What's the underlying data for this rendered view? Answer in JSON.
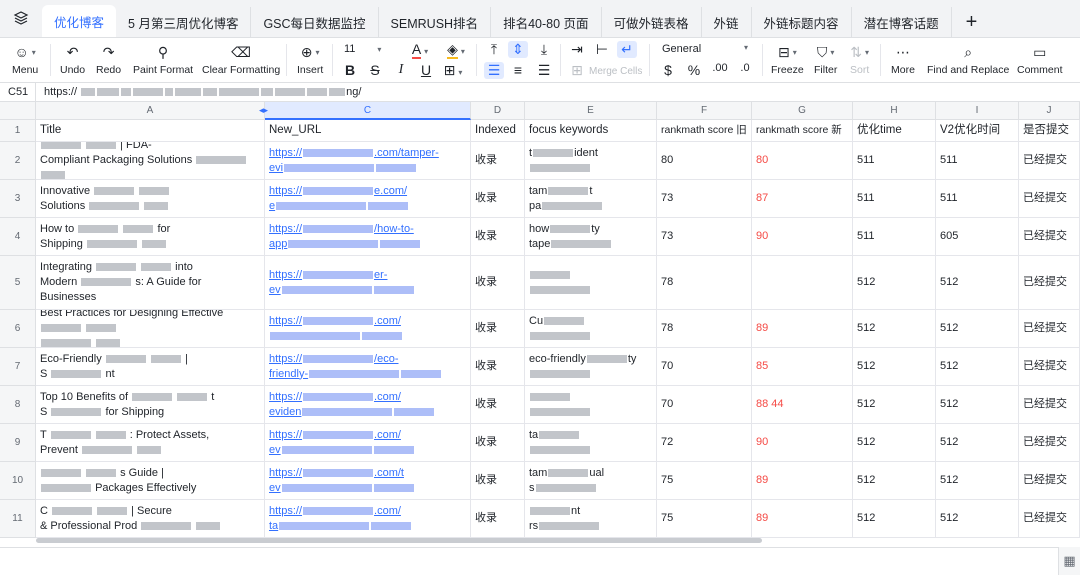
{
  "tabs": [
    {
      "label": "优化博客",
      "active": true
    },
    {
      "label": "5 月第三周优化博客"
    },
    {
      "label": "GSC每日数据监控"
    },
    {
      "label": "SEMRUSH排名"
    },
    {
      "label": "排名40-80 页面"
    },
    {
      "label": "可做外链表格"
    },
    {
      "label": "外链"
    },
    {
      "label": "外链标题内容"
    },
    {
      "label": "潜在博客话题"
    }
  ],
  "add_tab": "+",
  "toolbar": {
    "menu": "Menu",
    "undo": "Undo",
    "redo": "Redo",
    "paint_format": "Paint Format",
    "clear_formatting": "Clear Formatting",
    "insert": "Insert",
    "font_size": "11",
    "merge_cells": "Merge Cells",
    "number_format": "General",
    "currency": "$",
    "percent": "%",
    "freeze": "Freeze",
    "filter": "Filter",
    "sort": "Sort",
    "more": "More",
    "find_replace": "Find and Replace",
    "comment": "Comment"
  },
  "formula_bar": {
    "cell_ref": "C51",
    "value": "https://",
    "value_tail": "ng/"
  },
  "columns": [
    {
      "letter": "A",
      "header": "Title"
    },
    {
      "letter": "C",
      "header": "New_URL"
    },
    {
      "letter": "D",
      "header": "Indexed"
    },
    {
      "letter": "E",
      "header": "focus keywords"
    },
    {
      "letter": "F",
      "header": "rankmath score 旧"
    },
    {
      "letter": "G",
      "header": "rankmath score 新"
    },
    {
      "letter": "H",
      "header": "优化time"
    },
    {
      "letter": "I",
      "header": "V2优化时间"
    },
    {
      "letter": "J",
      "header": "是否提交"
    }
  ],
  "row_numbers": [
    "1",
    "2",
    "3",
    "4",
    "5",
    "6",
    "7",
    "8",
    "9",
    "10",
    "11"
  ],
  "rows": [
    {
      "title1": "",
      "title2": "| FDA-",
      "title3": "Compliant Packaging Solutions",
      "url1": "https://",
      "url1b": ".com/tamper-",
      "url2": "evi",
      "idx": "收录",
      "kw1": "t",
      "kw1b": "ident",
      "kw2": "",
      "old": "80",
      "new": "80",
      "h": "511",
      "i": "511",
      "j": "已经提交"
    },
    {
      "title1": "Innovative",
      "title2": "",
      "title3": "Solutions",
      "url1": "https://",
      "url1b": "e.com/",
      "url2": "e",
      "idx": "收录",
      "kw1": "tam",
      "kw1b": "t",
      "kw2": "pa",
      "old": "73",
      "new": "87",
      "h": "511",
      "i": "511",
      "j": "已经提交"
    },
    {
      "title1": "How to",
      "title2": "for",
      "title3": "Shipping",
      "url1": "https://",
      "url1b": "/how-to-",
      "url2": "app",
      "idx": "收录",
      "kw1": "how",
      "kw1b": "ty",
      "kw2": "tape",
      "old": "73",
      "new": "90",
      "h": "511",
      "i": "605",
      "j": "已经提交"
    },
    {
      "title1": "Integrating",
      "title2": "into",
      "title3": "Modern",
      "title4": "s: A Guide for",
      "title5": "Businesses",
      "url1": "https://",
      "url1b": "er-",
      "url2": "ev",
      "idx": "收录",
      "kw1": "",
      "kw1b": "",
      "kw2": "",
      "old": "78",
      "new": "",
      "h": "512",
      "i": "512",
      "j": "已经提交"
    },
    {
      "title1": "Best Practices for Designing Effective",
      "title2": "",
      "title3": "",
      "url1": "https://",
      "url1b": ".com/",
      "url2": "",
      "idx": "收录",
      "kw1": "Cu",
      "kw1b": "",
      "kw2": "",
      "old": "78",
      "new": "89",
      "h": "512",
      "i": "512",
      "j": "已经提交"
    },
    {
      "title1": "Eco-Friendly",
      "title2": "|",
      "title3": "S",
      "title4": "nt",
      "url1": "https://",
      "url1b": "/eco-",
      "url2": "friendly-",
      "idx": "收录",
      "kw1": "eco-friendly",
      "kw1b": "ty",
      "kw2": "",
      "old": "70",
      "new": "85",
      "h": "512",
      "i": "512",
      "j": "已经提交"
    },
    {
      "title1": "Top 10 Benefits of",
      "title2": "t",
      "title3": "S",
      "title4": "for Shipping",
      "url1": "https://",
      "url1b": ".com/",
      "url2": "eviden",
      "idx": "收录",
      "kw1": "",
      "kw1b": "",
      "kw2": "",
      "old": "70",
      "new": "88 44",
      "h": "512",
      "i": "512",
      "j": "已经提交"
    },
    {
      "title1": "T",
      "title2": ": Protect Assets,",
      "title3": "Prevent",
      "url1": "https://",
      "url1b": ".com/",
      "url2": "ev",
      "idx": "收录",
      "kw1": "ta",
      "kw1b": "",
      "kw2": "",
      "old": "72",
      "new": "90",
      "h": "512",
      "i": "512",
      "j": "已经提交"
    },
    {
      "title1": "",
      "title2": "s Guide |",
      "title3": "",
      "title4": "Packages Effectively",
      "url1": "https://",
      "url1b": ".com/t",
      "url2": "ev",
      "idx": "收录",
      "kw1": "tam",
      "kw1b": "ual",
      "kw2": "s",
      "old": "75",
      "new": "89",
      "h": "512",
      "i": "512",
      "j": "已经提交"
    },
    {
      "title1": "C",
      "title2": "| Secure",
      "title3": "& Professional Prod",
      "url1": "https://",
      "url1b": ".com/",
      "url2": "ta",
      "idx": "收录",
      "kw1": "",
      "kw1b": "nt",
      "kw2": "rs",
      "old": "75",
      "new": "89",
      "h": "512",
      "i": "512",
      "j": "已经提交"
    }
  ]
}
